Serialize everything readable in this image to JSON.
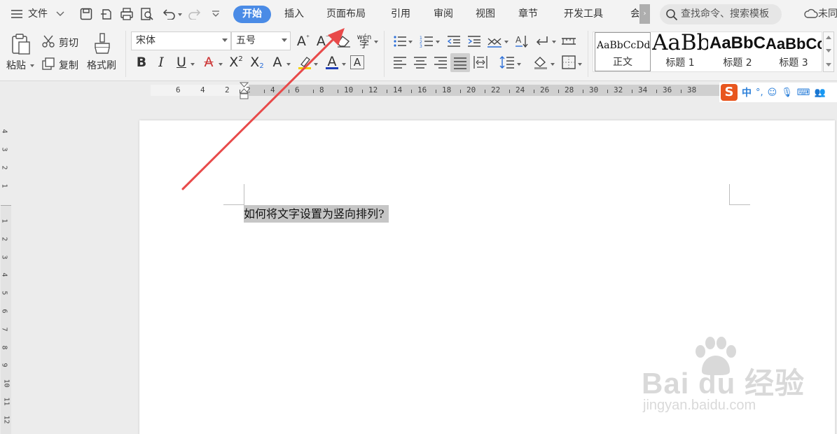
{
  "menubar": {
    "file_label": "文件",
    "tabs": [
      "开始",
      "插入",
      "页面布局",
      "引用",
      "审阅",
      "视图",
      "章节",
      "开发工具",
      "会"
    ],
    "search_label": "查找命令、搜索模板",
    "sync_label": "未同"
  },
  "clipboard": {
    "paste": "粘贴",
    "cut": "剪切",
    "copy": "复制",
    "format_painter": "格式刷"
  },
  "font": {
    "family": "宋体",
    "size": "五号",
    "bold": "B",
    "italic": "I",
    "underline": "U",
    "phonetic": "wén"
  },
  "styles": [
    {
      "preview": "AaBbCcDd",
      "name": "正文"
    },
    {
      "preview": "AaBb",
      "name": "标题 1"
    },
    {
      "preview": "AaBbC",
      "name": "标题 2"
    },
    {
      "preview": "AaBbCc",
      "name": "标题 3"
    }
  ],
  "ruler": {
    "left_numbers": [
      "6",
      "4",
      "2"
    ],
    "numbers": [
      "2",
      "4",
      "6",
      "8",
      "10",
      "12",
      "14",
      "16",
      "18",
      "20",
      "22",
      "24",
      "26",
      "28",
      "30",
      "32",
      "34",
      "36",
      "38"
    ]
  },
  "vruler": {
    "top_numbers": [
      "4",
      "3",
      "2",
      "1"
    ],
    "numbers": [
      "1",
      "2",
      "3",
      "4",
      "5",
      "6",
      "7",
      "8",
      "9",
      "10",
      "11",
      "12"
    ]
  },
  "ime": {
    "logo": "S",
    "mode": "中"
  },
  "document": {
    "text": "如何将文字设置为竖向排列?"
  },
  "watermark": {
    "brand": "Bai du 经验",
    "url": "jingyan.baidu.com"
  },
  "colors": {
    "accent": "#4a8be6",
    "arrow": "#e84a4a",
    "font_color": "#1f3fb8",
    "highlight": "#c6c6c6"
  }
}
